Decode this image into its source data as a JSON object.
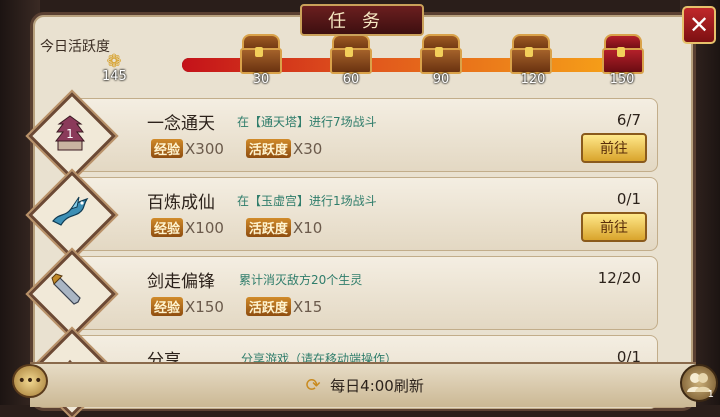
{
  "window": {
    "title": "任务",
    "close_label": "✕"
  },
  "activity": {
    "label": "今日活跃度",
    "value": "145",
    "progress": 0.965,
    "milestones": [
      {
        "label": "30",
        "type": "wooden"
      },
      {
        "label": "60",
        "type": "wooden"
      },
      {
        "label": "90",
        "type": "wooden"
      },
      {
        "label": "120",
        "type": "wooden"
      },
      {
        "label": "150",
        "type": "red"
      }
    ]
  },
  "reward_tags": {
    "exp": "经验",
    "active": "活跃度"
  },
  "tasks": [
    {
      "name": "一念通天",
      "desc": "在【通天塔】进行7场战斗",
      "progress": "6/7",
      "exp": "X300",
      "active": "X30",
      "button": "前往",
      "icon": "tower-icon",
      "icon_badge": "1"
    },
    {
      "name": "百炼成仙",
      "desc": "在【玉虚宫】进行1场战斗",
      "progress": "0/1",
      "exp": "X100",
      "active": "X10",
      "button": "前往",
      "icon": "dragon-icon"
    },
    {
      "name": "剑走偏锋",
      "desc": "累计消灭敌方20个生灵",
      "progress": "12/20",
      "exp": "X150",
      "active": "X15",
      "icon": "sword-icon"
    },
    {
      "name": "分享",
      "desc": "分享游戏（请在移动端操作）",
      "progress": "0/1",
      "icon": "share-icon"
    }
  ],
  "footer": {
    "refresh_text": "每日4:00刷新"
  },
  "friends": {
    "count": "1"
  },
  "colors": {
    "accent": "#d9a42c",
    "desc_text": "#2f7d6b",
    "panel": "#e9e1d0"
  }
}
